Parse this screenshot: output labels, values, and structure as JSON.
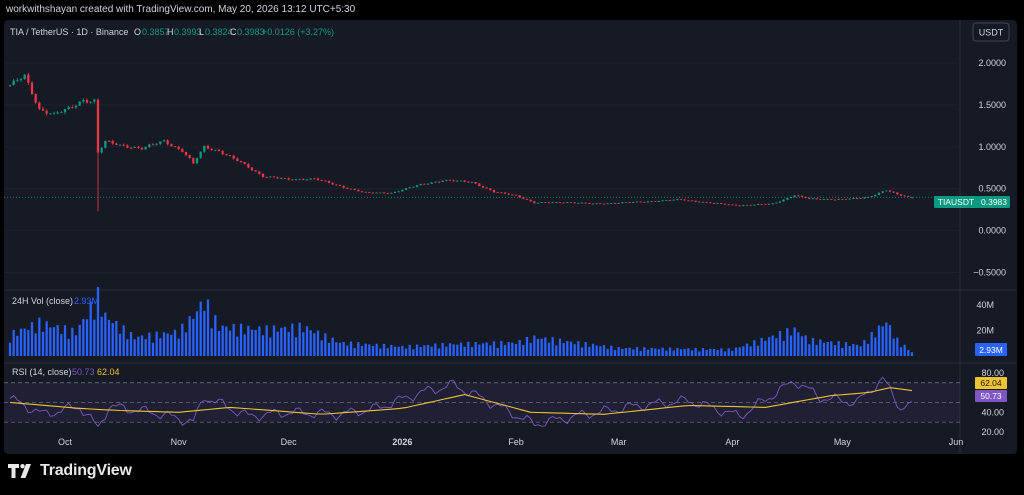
{
  "header": {
    "credit": "workwithshayan created with TradingView.com, May 20, 2026 13:12 UTC+5:30"
  },
  "legend": {
    "symbol": "TIA / TetherUS · 1D · Binance",
    "open_label": "O",
    "open": "0.3857",
    "high_label": "H",
    "high": "0.3993",
    "low_label": "L",
    "low": "0.3824",
    "close_label": "C",
    "close": "0.3983",
    "change": "+0.0126 (+3.27%)"
  },
  "volume_legend": {
    "title": "24H Vol (close)",
    "value": "2.93M"
  },
  "rsi_legend": {
    "title": "RSI (14, close)",
    "rsi_value": "50.73",
    "ma_value": "62.04"
  },
  "price_scale": {
    "currency_button": "USDT",
    "symbol_tag": "TIAUSDT",
    "last_price": "0.3983",
    "ticks": [
      "2.0000",
      "1.5000",
      "1.0000",
      "0.5000",
      "0.0000",
      "−0.5000"
    ],
    "volume_ticks": [
      "40M",
      "20M"
    ],
    "rsi_ticks": [
      "80.00",
      "40.00",
      "20.00"
    ]
  },
  "footer": {
    "brand": "TradingView"
  },
  "colors": {
    "background": "#161a25",
    "up": "#089981",
    "down": "#f23645",
    "volume": "#2962ff",
    "rsi": "#7e57c2",
    "rsi_ma": "#f0c330",
    "text": "#d1d4dc"
  },
  "chart_data": [
    {
      "type": "candlestick",
      "title": "TIA / TetherUS · 1D · Binance",
      "ylim": [
        -0.65,
        2.3
      ],
      "y_ticks": [
        2.0,
        1.5,
        1.0,
        0.5,
        0.0,
        -0.5
      ],
      "x_labels": [
        "Oct",
        "Nov",
        "Dec",
        "2026",
        "Feb",
        "Mar",
        "Apr",
        "May",
        "Jun"
      ],
      "close_path": [
        {
          "date": "2025-09-16",
          "close": 1.74
        },
        {
          "date": "2025-09-20",
          "close": 1.84
        },
        {
          "date": "2025-09-24",
          "close": 1.45
        },
        {
          "date": "2025-09-28",
          "close": 1.39
        },
        {
          "date": "2025-10-02",
          "close": 1.45
        },
        {
          "date": "2025-10-06",
          "close": 1.56
        },
        {
          "date": "2025-10-09",
          "close": 1.55
        },
        {
          "date": "2025-10-10",
          "close": 0.93
        },
        {
          "date": "2025-10-12",
          "close": 1.06
        },
        {
          "date": "2025-10-16",
          "close": 1.02
        },
        {
          "date": "2025-10-22",
          "close": 0.98
        },
        {
          "date": "2025-10-28",
          "close": 1.07
        },
        {
          "date": "2025-11-02",
          "close": 0.95
        },
        {
          "date": "2025-11-05",
          "close": 0.8
        },
        {
          "date": "2025-11-08",
          "close": 1.0
        },
        {
          "date": "2025-11-12",
          "close": 0.95
        },
        {
          "date": "2025-11-18",
          "close": 0.81
        },
        {
          "date": "2025-11-24",
          "close": 0.65
        },
        {
          "date": "2025-12-01",
          "close": 0.61
        },
        {
          "date": "2025-12-08",
          "close": 0.62
        },
        {
          "date": "2025-12-15",
          "close": 0.53
        },
        {
          "date": "2025-12-22",
          "close": 0.45
        },
        {
          "date": "2025-12-29",
          "close": 0.45
        },
        {
          "date": "2026-01-06",
          "close": 0.55
        },
        {
          "date": "2026-01-12",
          "close": 0.6
        },
        {
          "date": "2026-01-20",
          "close": 0.58
        },
        {
          "date": "2026-01-26",
          "close": 0.46
        },
        {
          "date": "2026-02-01",
          "close": 0.42
        },
        {
          "date": "2026-02-06",
          "close": 0.33
        },
        {
          "date": "2026-02-14",
          "close": 0.34
        },
        {
          "date": "2026-02-22",
          "close": 0.32
        },
        {
          "date": "2026-03-01",
          "close": 0.33
        },
        {
          "date": "2026-03-10",
          "close": 0.35
        },
        {
          "date": "2026-03-18",
          "close": 0.37
        },
        {
          "date": "2026-03-26",
          "close": 0.33
        },
        {
          "date": "2026-04-03",
          "close": 0.3
        },
        {
          "date": "2026-04-12",
          "close": 0.32
        },
        {
          "date": "2026-04-18",
          "close": 0.42
        },
        {
          "date": "2026-04-22",
          "close": 0.38
        },
        {
          "date": "2026-05-01",
          "close": 0.37
        },
        {
          "date": "2026-05-08",
          "close": 0.4
        },
        {
          "date": "2026-05-13",
          "close": 0.48
        },
        {
          "date": "2026-05-16",
          "close": 0.43
        },
        {
          "date": "2026-05-20",
          "close": 0.398
        }
      ],
      "last": {
        "open": 0.3857,
        "high": 0.3993,
        "low": 0.3824,
        "close": 0.3983,
        "change": 0.0126,
        "change_pct": 3.27
      },
      "notable_wicks": [
        {
          "date": "2025-10-10",
          "low": 0.23
        }
      ]
    },
    {
      "type": "bar",
      "title": "24H Vol (close)",
      "y_unit": "M",
      "ylim": [
        0,
        50
      ],
      "y_ticks": [
        40,
        20
      ],
      "points": [
        {
          "date": "2025-09-16",
          "value": 16
        },
        {
          "date": "2025-09-24",
          "value": 25
        },
        {
          "date": "2025-10-04",
          "value": 18
        },
        {
          "date": "2025-10-10",
          "value": 45
        },
        {
          "date": "2025-10-12",
          "value": 30
        },
        {
          "date": "2025-10-20",
          "value": 14
        },
        {
          "date": "2025-11-01",
          "value": 18
        },
        {
          "date": "2025-11-05",
          "value": 30
        },
        {
          "date": "2025-11-08",
          "value": 42
        },
        {
          "date": "2025-11-12",
          "value": 22
        },
        {
          "date": "2025-11-25",
          "value": 20
        },
        {
          "date": "2025-12-05",
          "value": 22
        },
        {
          "date": "2025-12-15",
          "value": 10
        },
        {
          "date": "2026-01-01",
          "value": 7
        },
        {
          "date": "2026-01-15",
          "value": 9
        },
        {
          "date": "2026-02-01",
          "value": 10
        },
        {
          "date": "2026-02-06",
          "value": 14
        },
        {
          "date": "2026-03-01",
          "value": 6
        },
        {
          "date": "2026-04-01",
          "value": 5
        },
        {
          "date": "2026-04-18",
          "value": 20
        },
        {
          "date": "2026-04-22",
          "value": 12
        },
        {
          "date": "2026-05-06",
          "value": 8
        },
        {
          "date": "2026-05-13",
          "value": 26
        },
        {
          "date": "2026-05-16",
          "value": 12
        },
        {
          "date": "2026-05-20",
          "value": 2.93
        }
      ],
      "last_value": "2.93M"
    },
    {
      "type": "line",
      "title": "RSI (14, close)",
      "ylim": [
        18,
        88
      ],
      "y_ticks": [
        80,
        40,
        20
      ],
      "band": [
        30,
        70
      ],
      "series": [
        {
          "name": "RSI",
          "points": [
            {
              "date": "2025-09-16",
              "value": 54
            },
            {
              "date": "2025-09-25",
              "value": 38
            },
            {
              "date": "2025-10-05",
              "value": 46
            },
            {
              "date": "2025-10-10",
              "value": 24
            },
            {
              "date": "2025-10-13",
              "value": 46
            },
            {
              "date": "2025-10-25",
              "value": 40
            },
            {
              "date": "2025-11-05",
              "value": 30
            },
            {
              "date": "2025-11-08",
              "value": 56
            },
            {
              "date": "2025-11-20",
              "value": 36
            },
            {
              "date": "2025-12-01",
              "value": 40
            },
            {
              "date": "2025-12-15",
              "value": 38
            },
            {
              "date": "2025-12-25",
              "value": 44
            },
            {
              "date": "2026-01-06",
              "value": 60
            },
            {
              "date": "2026-01-15",
              "value": 68
            },
            {
              "date": "2026-01-25",
              "value": 50
            },
            {
              "date": "2026-02-06",
              "value": 28
            },
            {
              "date": "2026-02-20",
              "value": 38
            },
            {
              "date": "2026-03-05",
              "value": 46
            },
            {
              "date": "2026-03-20",
              "value": 52
            },
            {
              "date": "2026-04-03",
              "value": 36
            },
            {
              "date": "2026-04-18",
              "value": 72
            },
            {
              "date": "2026-04-25",
              "value": 55
            },
            {
              "date": "2026-05-05",
              "value": 50
            },
            {
              "date": "2026-05-12",
              "value": 74
            },
            {
              "date": "2026-05-17",
              "value": 44
            },
            {
              "date": "2026-05-20",
              "value": 50.73
            }
          ]
        },
        {
          "name": "RSI-based MA",
          "points": [
            {
              "date": "2025-09-16",
              "value": 50
            },
            {
              "date": "2025-10-05",
              "value": 44
            },
            {
              "date": "2025-10-15",
              "value": 42
            },
            {
              "date": "2025-11-01",
              "value": 40
            },
            {
              "date": "2025-11-15",
              "value": 45
            },
            {
              "date": "2025-12-10",
              "value": 38
            },
            {
              "date": "2026-01-01",
              "value": 44
            },
            {
              "date": "2026-01-18",
              "value": 58
            },
            {
              "date": "2026-02-05",
              "value": 40
            },
            {
              "date": "2026-02-25",
              "value": 38
            },
            {
              "date": "2026-03-20",
              "value": 47
            },
            {
              "date": "2026-04-10",
              "value": 45
            },
            {
              "date": "2026-04-28",
              "value": 57
            },
            {
              "date": "2026-05-08",
              "value": 60
            },
            {
              "date": "2026-05-14",
              "value": 65
            },
            {
              "date": "2026-05-20",
              "value": 62.04
            }
          ]
        }
      ]
    }
  ]
}
